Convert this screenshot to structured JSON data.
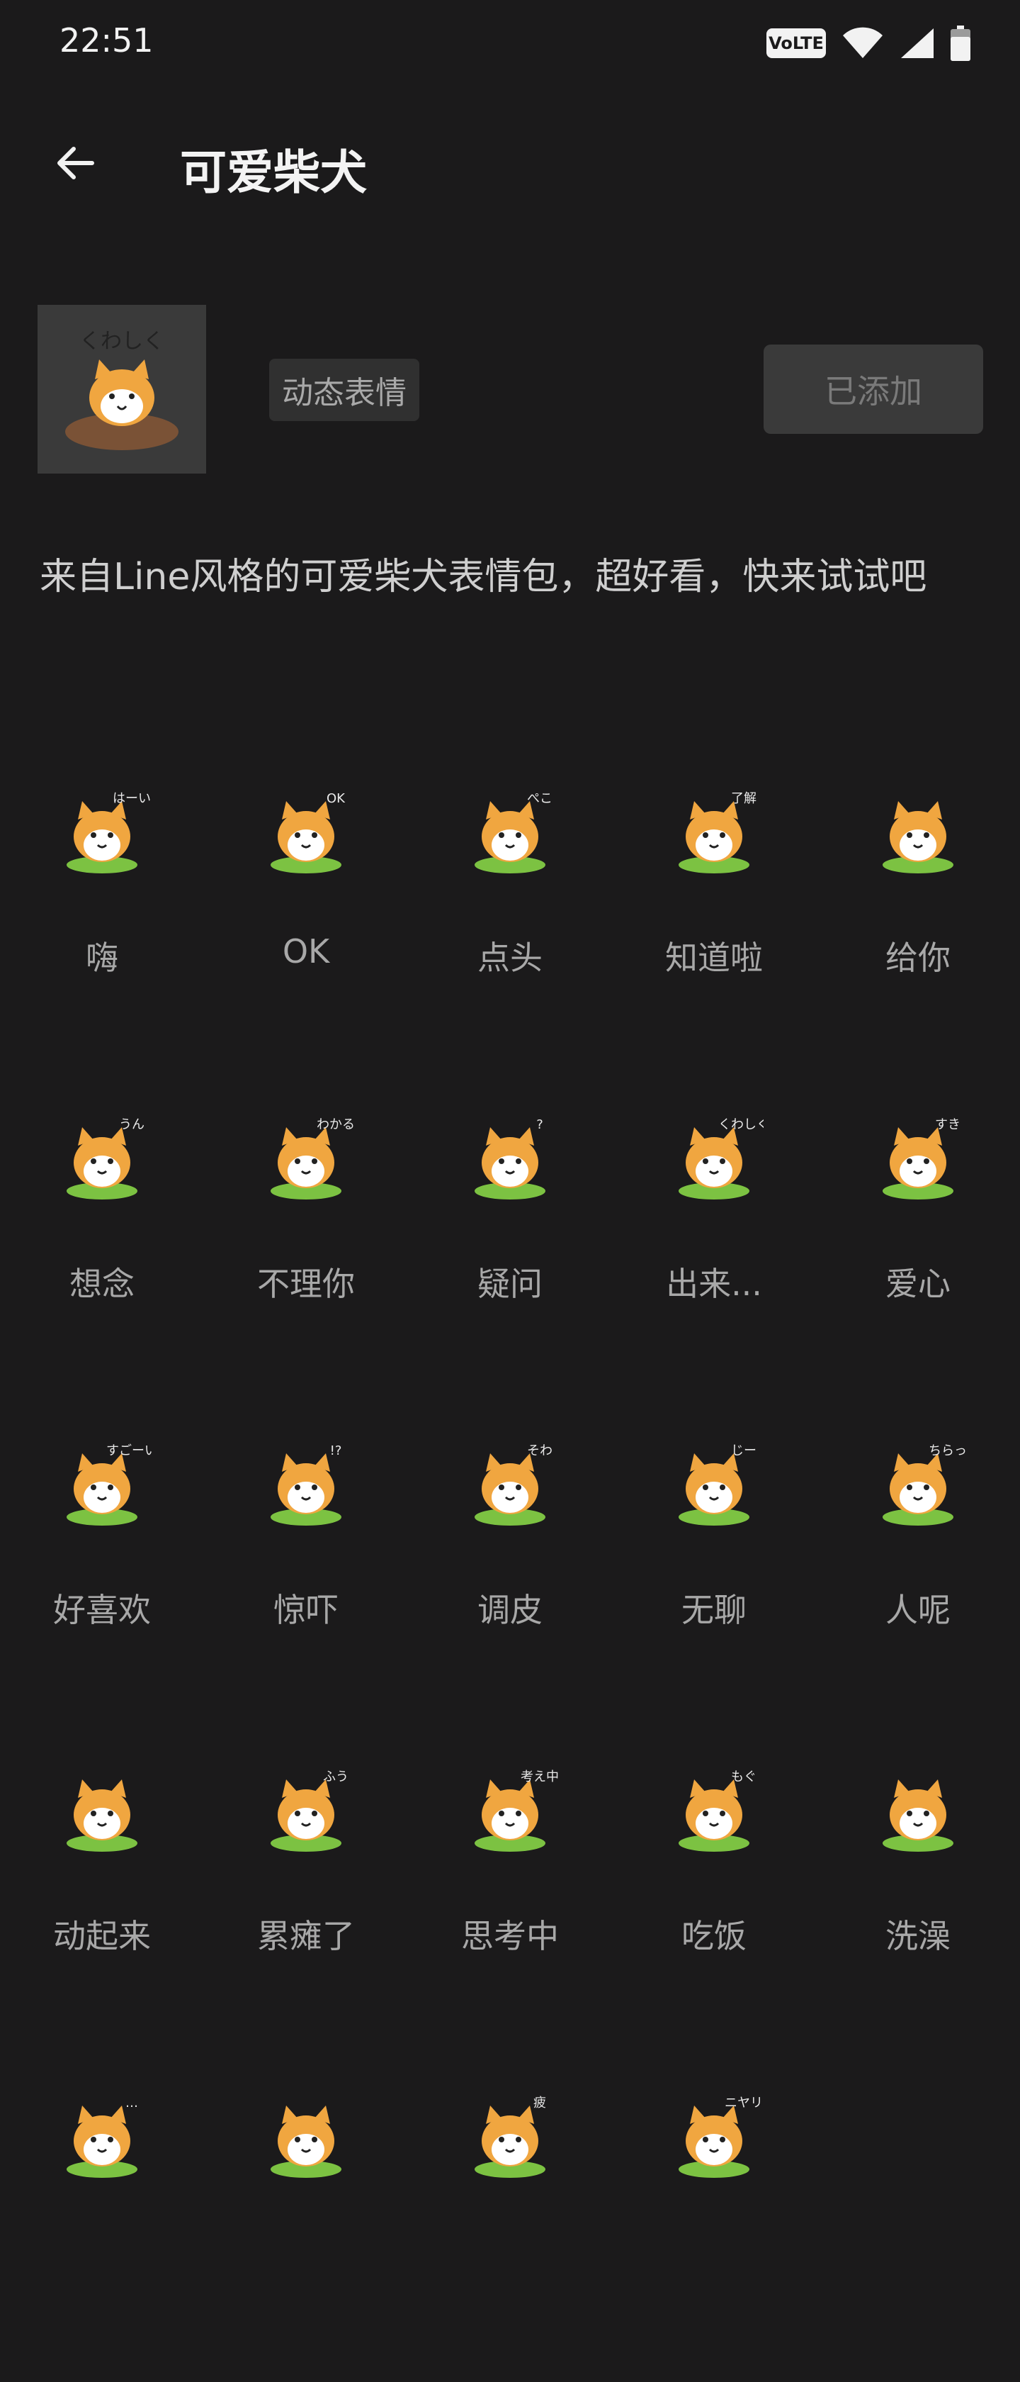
{
  "status_bar": {
    "time": "22:51",
    "volte_label": "VoLTE"
  },
  "header": {
    "title": "可爱柴犬"
  },
  "pack": {
    "thumb_text": "くわしく",
    "tag": "动态表情",
    "added_button": "已添加",
    "description": "来自Line风格的可爱柴犬表情包，超好看，快来试试吧"
  },
  "stickers": [
    {
      "label": "嗨",
      "icon": "shiba-wave-icon",
      "caption": "はーい"
    },
    {
      "label": "OK",
      "icon": "shiba-ok-icon",
      "caption": "OK"
    },
    {
      "label": "点头",
      "icon": "shiba-nod-icon",
      "caption": "ぺこ"
    },
    {
      "label": "知道啦",
      "icon": "shiba-sign-icon",
      "caption": "了解"
    },
    {
      "label": "给你",
      "icon": "shiba-give-icon",
      "caption": ""
    },
    {
      "label": "想念",
      "icon": "shiba-hearts-icon",
      "caption": "うん"
    },
    {
      "label": "不理你",
      "icon": "shiba-bubble-icon",
      "caption": "わかる"
    },
    {
      "label": "疑问",
      "icon": "shiba-question-icon",
      "caption": "?"
    },
    {
      "label": "出来...",
      "icon": "shiba-dig-icon",
      "caption": "くわしく"
    },
    {
      "label": "爱心",
      "icon": "shiba-heart-icon",
      "caption": "すき"
    },
    {
      "label": "好喜欢",
      "icon": "shiba-sparkle-icon",
      "caption": "すごーい"
    },
    {
      "label": "惊吓",
      "icon": "shiba-shock-icon",
      "caption": "!?"
    },
    {
      "label": "调皮",
      "icon": "shiba-bowl-icon",
      "caption": "そわ"
    },
    {
      "label": "无聊",
      "icon": "shiba-peek-icon",
      "caption": "じー"
    },
    {
      "label": "人呢",
      "icon": "shiba-house-icon",
      "caption": "ちらっ"
    },
    {
      "label": "动起来",
      "icon": "shiba-roll-icon",
      "caption": ""
    },
    {
      "label": "累瘫了",
      "icon": "shiba-pillow-icon",
      "caption": "ふう"
    },
    {
      "label": "思考中",
      "icon": "shiba-think-icon",
      "caption": "考え中"
    },
    {
      "label": "吃饭",
      "icon": "shiba-eat-icon",
      "caption": "もぐ"
    },
    {
      "label": "洗澡",
      "icon": "shiba-bath-icon",
      "caption": ""
    },
    {
      "label": "",
      "icon": "shiba-dots-icon",
      "caption": "…"
    },
    {
      "label": "",
      "icon": "shiba-leash-icon",
      "caption": ""
    },
    {
      "label": "",
      "icon": "shiba-tired-icon",
      "caption": "疲"
    },
    {
      "label": "",
      "icon": "shiba-smirk-icon",
      "caption": "ニヤリ"
    }
  ],
  "colors": {
    "background": "#1b1a1b",
    "fur": "#f0a640",
    "grass": "#7cc242",
    "accent_red": "#e8323c"
  }
}
